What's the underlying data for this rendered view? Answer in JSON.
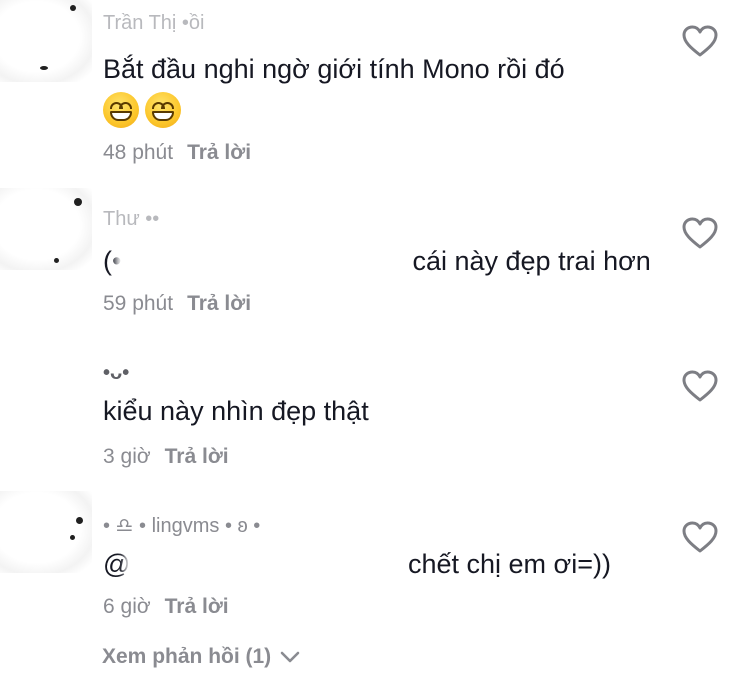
{
  "comments": [
    {
      "username": "Trần Thị •ồi",
      "text": "Bắt đầu nghi ngờ giới tính Mono rồi đó",
      "emojis": [
        "grinning-face-icon",
        "grinning-face-icon"
      ],
      "time": "48 phút",
      "reply_label": "Trả lời"
    },
    {
      "username": "Thư ••",
      "text_prefix": "(•",
      "text_rest": "cái này đẹp trai hơn",
      "time": "59 phút",
      "reply_label": "Trả lời"
    },
    {
      "username": "•ᴗ•",
      "text": "kiểu này nhìn đẹp thật",
      "time": "3 giờ",
      "reply_label": "Trả lời"
    },
    {
      "username": "• ♎ • lingvms • ʚ •",
      "text_prefix": "@",
      "text_rest": "chết chị em ơi=))",
      "time": "6 giờ",
      "reply_label": "Trả lời"
    }
  ],
  "view_replies_label": "Xem phản hồi (1)",
  "colors": {
    "text": "#161823",
    "muted": "#8a8b91",
    "background": "#ffffff"
  }
}
